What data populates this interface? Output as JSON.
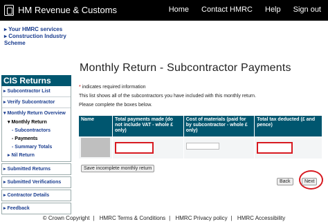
{
  "header": {
    "logo_text": "HM Revenue & Customs",
    "nav": [
      "Home",
      "Contact HMRC",
      "Help",
      "Sign out"
    ]
  },
  "breadcrumb": [
    "▸ Your HMRC services",
    "▸ Construction Industry Scheme"
  ],
  "page_title": "Monthly Return - Subcontractor Payments",
  "sidebar": {
    "heading": "CIS Returns",
    "items": [
      "▸ Subcontractor List",
      "▸ Verify Subcontractor",
      "▾ Monthly Return Overview"
    ],
    "sub_items": {
      "monthly_return": "▾ Monthly Return",
      "subcontractors": "- Subcontractors",
      "payments": "- Payments",
      "summary_totals": "- Summary Totals",
      "nil_return": "▸ Nil Return"
    },
    "bottom_items": [
      "▸ Submitted Returns",
      "▸ Submitted Verifications",
      "▸ Contractor Details",
      "▸ Feedback"
    ]
  },
  "main": {
    "required_note_star": "*",
    "required_note": " indicates required information",
    "intro": "This list shows all of the subcontractors you have included with this monthly return.",
    "instruction": "Please complete the boxes below."
  },
  "table": {
    "headers": [
      "Name",
      "Total payments made (do not include VAT - whole £ only)",
      "Cost of materials (paid for by subcontractor - whole £ only)",
      "Total tax deducted (£ and pence)"
    ]
  },
  "buttons": {
    "save": "Save incomplete monthly return",
    "back": "Back",
    "next": "Next"
  },
  "footer": [
    "© Crown Copyright",
    "HMRC Terms & Conditions",
    "HMRC Privacy policy",
    "HMRC Accessibility"
  ],
  "colors": {
    "header_bg": "#000000",
    "accent_teal": "#00566f",
    "link_blue": "#1a3d8f",
    "highlight_red": "#d71920"
  }
}
